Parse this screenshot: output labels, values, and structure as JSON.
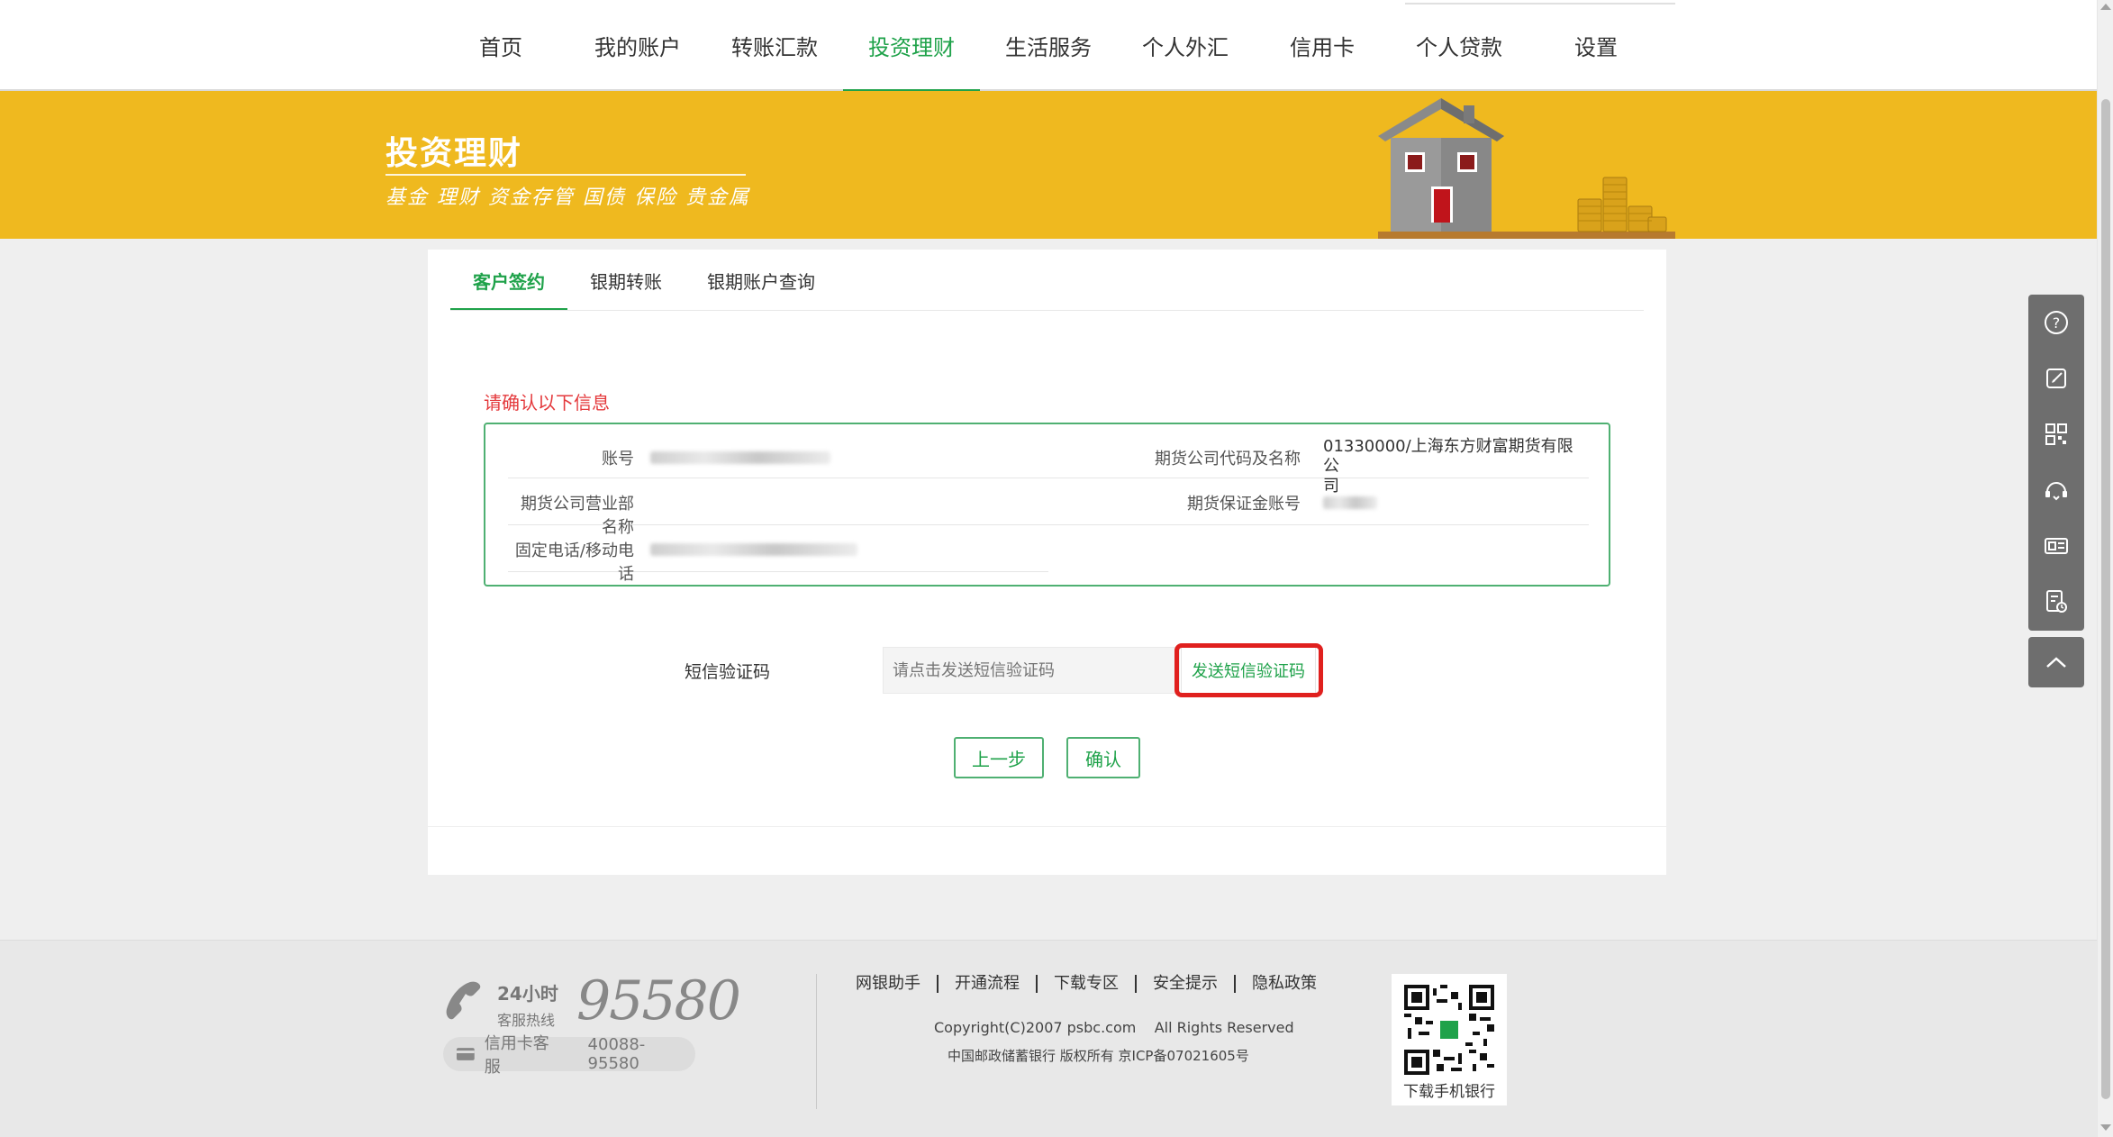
{
  "nav": {
    "items": [
      "首页",
      "我的账户",
      "转账汇款",
      "投资理财",
      "生活服务",
      "个人外汇",
      "信用卡",
      "个人贷款",
      "设置"
    ],
    "active_index": 3
  },
  "banner": {
    "title": "投资理财",
    "subtitle": "基金 理财 资金存管 国债 保险 贵金属"
  },
  "tabs": {
    "items": [
      "客户签约",
      "银期转账",
      "银期账户查询"
    ],
    "active_index": 0
  },
  "form": {
    "hint": "请确认以下信息",
    "fields": {
      "account_label": "账号",
      "futures_company_label": "期货公司代码及名称",
      "futures_company_value_line1": "01330000/上海东方财富期货有限公",
      "futures_company_value_line2": "司",
      "branch_label": "期货公司营业部名称",
      "margin_account_label": "期货保证金账号",
      "phone_label": "固定电话/移动电话"
    },
    "sms_label": "短信验证码",
    "sms_placeholder": "请点击发送短信验证码",
    "sms_button": "发送短信验证码",
    "prev_button": "上一步",
    "confirm_button": "确认"
  },
  "sidetools": [
    "help-icon",
    "edit-icon",
    "qrcode-icon",
    "headset-icon",
    "card-icon",
    "document-icon"
  ],
  "footer": {
    "hotline_hours": "24小时",
    "hotline_label": "客服热线",
    "hotline_number": "95580",
    "credit_card_label": "信用卡客服",
    "credit_card_number": "40088-95580",
    "links": [
      "网银助手",
      "开通流程",
      "下载专区",
      "安全提示",
      "隐私政策"
    ],
    "copyright": "Copyright(C)2007 psbc.com    All Rights Reserved",
    "icp": "中国邮政储蓄银行 版权所有 京ICP备07021605号",
    "qr_label": "下载手机银行"
  },
  "colors": {
    "accent": "#1fa24a",
    "banner": "#efb91f",
    "alert": "#e4393c",
    "highlight": "#e0201e"
  }
}
